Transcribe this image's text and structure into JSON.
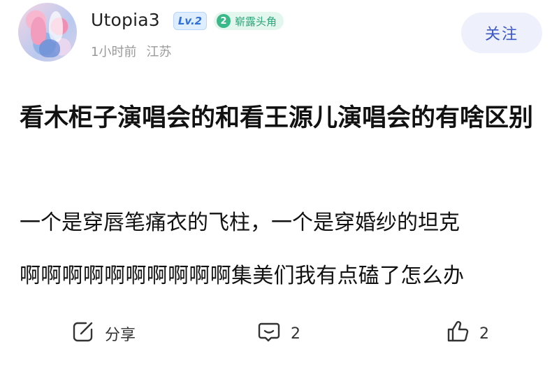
{
  "user": {
    "name": "Utopia3",
    "level": "Lv.2",
    "title_badge": {
      "number": "2",
      "text": "崭露头角"
    },
    "time": "1小时前",
    "location": "江苏",
    "follow_label": "关注"
  },
  "post": {
    "title": "看木柜子演唱会的和看王源儿演唱会的有啥区别",
    "body_lines": [
      "一个是穿唇笔痛衣的飞柱，一个是穿婚纱的坦克",
      "啊啊啊啊啊啊啊啊啊啊集美们我有点磕了怎么办"
    ]
  },
  "actions": {
    "share_label": "分享",
    "comment_count": "2",
    "like_count": "2"
  },
  "colors": {
    "accent": "#3b57c8",
    "badge_green": "#39b98a",
    "level_blue": "#2e6fd8",
    "meta_gray": "#9a9a9a"
  },
  "icons": [
    "avatar",
    "share-icon",
    "comment-icon",
    "like-icon"
  ]
}
